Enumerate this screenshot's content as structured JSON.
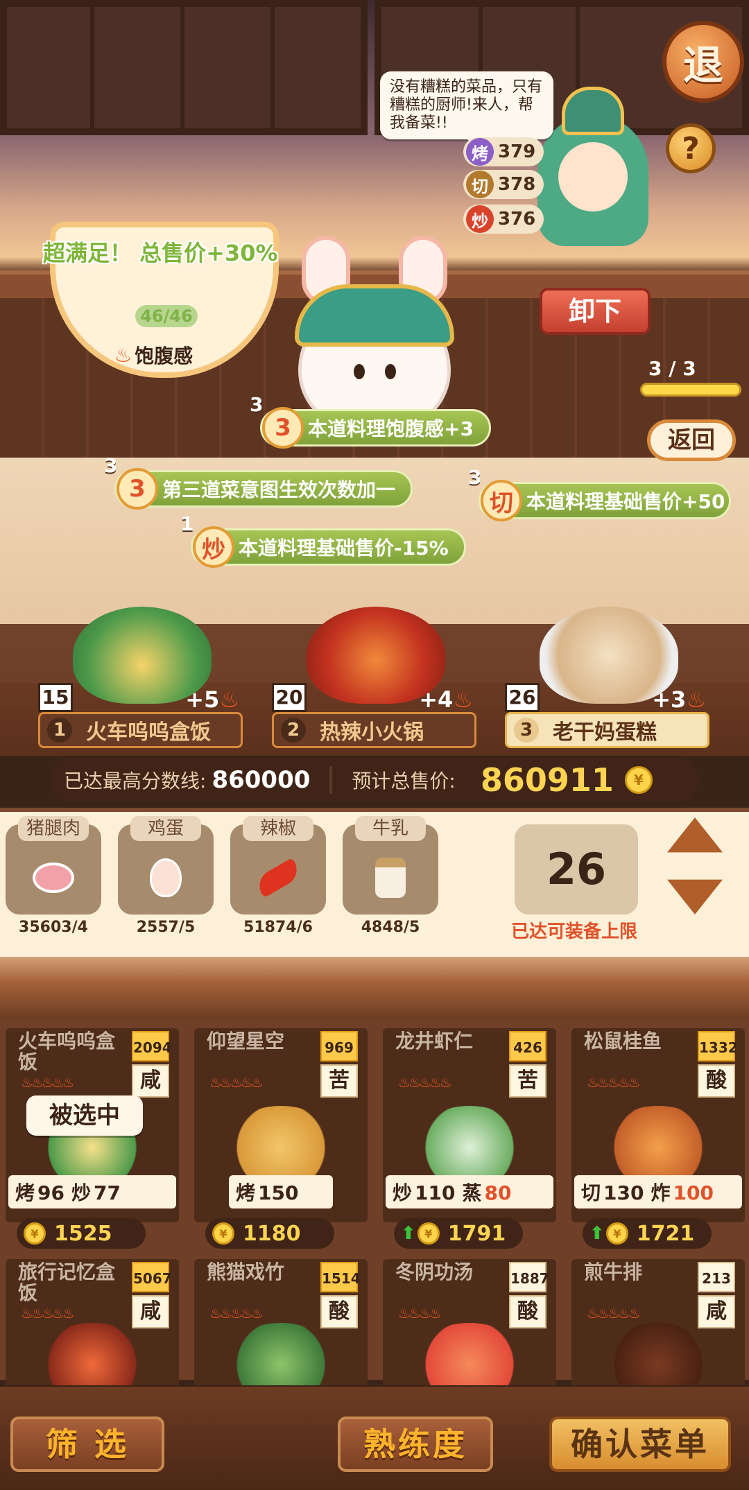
{
  "scene": {
    "retreat_label": "退",
    "help_label": "?",
    "speech": "没有糟糕的菜品，只有糟糕的厨师!来人，帮我备菜!!",
    "chef_skills": [
      {
        "icon": "烤",
        "value": "379",
        "color": "#8b5fc7"
      },
      {
        "icon": "切",
        "value": "378",
        "color": "#b27a2f"
      },
      {
        "icon": "炒",
        "value": "376",
        "color": "#d9432c"
      }
    ],
    "super_text": "超满足！ 总售价+30%",
    "bowl_progress": "46/46",
    "satiety_label": "饱腹感",
    "unload_label": "卸下",
    "page_indicator": "3 / 3",
    "return_label": "返回"
  },
  "tags": [
    {
      "count": "3",
      "badge": "3",
      "text": "本道料理饱腹感+3"
    },
    {
      "count": "3",
      "badge": "3",
      "text": "第三道菜意图生效次数加一"
    },
    {
      "count": "3",
      "badge": "切",
      "text": "本道料理基础售价+50"
    },
    {
      "count": "1",
      "badge": "炒",
      "text": "本道料理基础售价-15%"
    }
  ],
  "selected_dishes": [
    {
      "count": "15",
      "bonus": "+5",
      "num": "1",
      "name": "火车呜呜盒饭"
    },
    {
      "count": "20",
      "bonus": "+4",
      "num": "2",
      "name": "热辣小火锅"
    },
    {
      "count": "26",
      "bonus": "+3",
      "num": "3",
      "name": "老干妈蛋糕"
    }
  ],
  "score_bar": {
    "best_label": "已达最高分数线:",
    "best_value": "860000",
    "total_label": "预计总售价:",
    "total_value": "860911"
  },
  "ingredients": [
    {
      "name": "猪腿肉",
      "icon": "ham-icon",
      "qty": "35603/4"
    },
    {
      "name": "鸡蛋",
      "icon": "egg-icon",
      "qty": "2557/5"
    },
    {
      "name": "辣椒",
      "icon": "chili-icon",
      "qty": "51874/6"
    },
    {
      "name": "牛乳",
      "icon": "milk-icon",
      "qty": "4848/5"
    }
  ],
  "capacity": {
    "value": "26",
    "text": "已达可装备上限"
  },
  "recipes": [
    {
      "name": "火车呜呜盒饭",
      "score": "2094",
      "taste": "咸",
      "skills": [
        {
          "k": "烤",
          "v": "96",
          "hi": false
        },
        {
          "k": "炒",
          "v": "77",
          "hi": false
        }
      ],
      "price": "1525",
      "up": false,
      "selected": true
    },
    {
      "name": "仰望星空",
      "score": "969",
      "taste": "苦",
      "skills": [
        {
          "k": "烤",
          "v": "150",
          "hi": false
        }
      ],
      "price": "1180",
      "up": false,
      "selected": false
    },
    {
      "name": "龙井虾仁",
      "score": "426",
      "taste": "苦",
      "skills": [
        {
          "k": "炒",
          "v": "110",
          "hi": false
        },
        {
          "k": "蒸",
          "v": "80",
          "hi": true
        }
      ],
      "price": "1791",
      "up": true,
      "selected": false
    },
    {
      "name": "松鼠桂鱼",
      "score": "1332",
      "taste": "酸",
      "skills": [
        {
          "k": "切",
          "v": "130",
          "hi": false
        },
        {
          "k": "炸",
          "v": "100",
          "hi": true
        }
      ],
      "price": "1721",
      "up": true,
      "selected": false
    },
    {
      "name": "旅行记忆盒饭",
      "score": "5067",
      "taste": "咸"
    },
    {
      "name": "熊猫戏竹",
      "score": "1514",
      "taste": "酸"
    },
    {
      "name": "冬阴功汤",
      "score": "1887",
      "taste": "酸"
    },
    {
      "name": "煎牛排",
      "score": "213",
      "taste": "咸"
    }
  ],
  "selected_label": "被选中",
  "bottom": {
    "filter": "筛 选",
    "proficiency": "熟练度",
    "confirm": "确认菜单"
  }
}
